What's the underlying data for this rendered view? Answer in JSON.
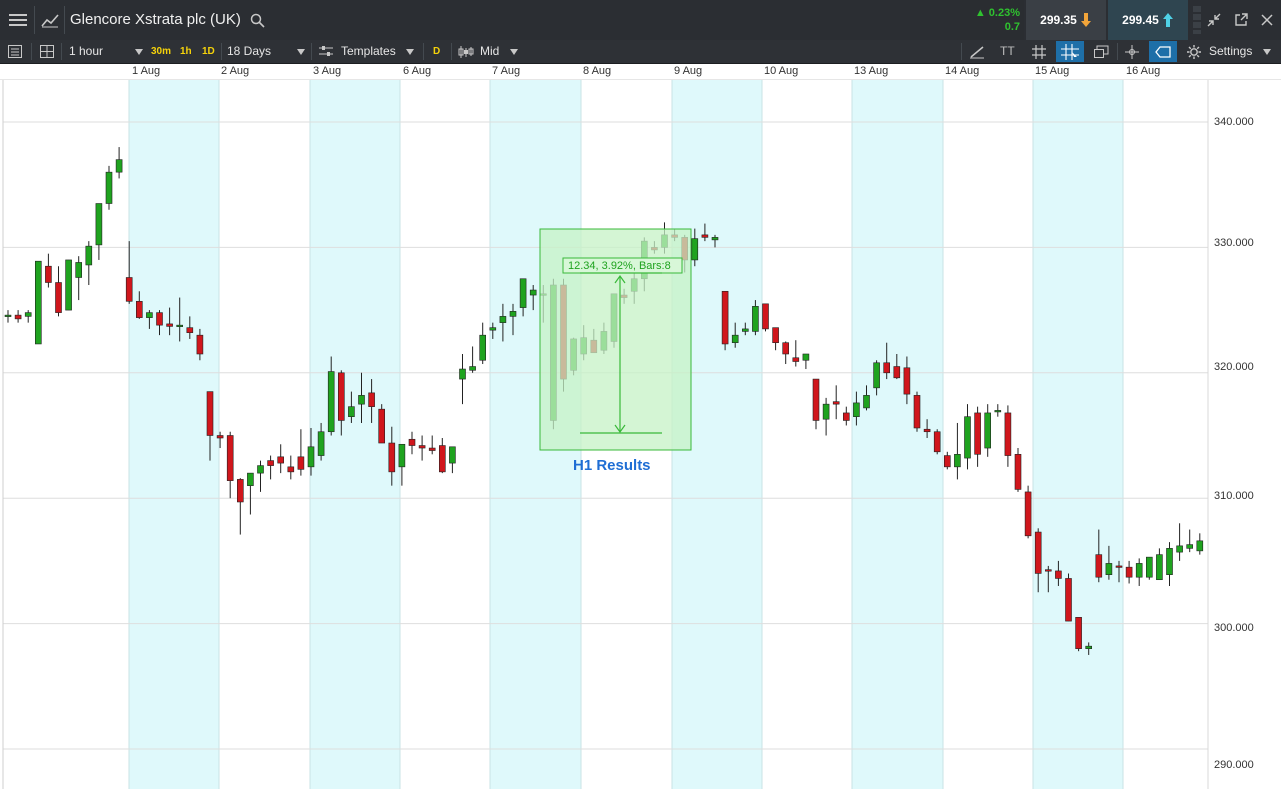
{
  "header": {
    "title": "Glencore Xstrata plc (UK)",
    "change_pct": "▲ 0.23%",
    "change_abs": "0.7",
    "sell_price": "299.35",
    "buy_price": "299.45"
  },
  "toolbar": {
    "interval": "1 hour",
    "quick_30m": "30m",
    "quick_1h": "1h",
    "quick_1d": "1D",
    "range": "18 Days",
    "templates": "Templates",
    "d_label": "D",
    "price_type": "Mid",
    "tt_label": "TT",
    "settings": "Settings"
  },
  "dates": [
    "1 Aug",
    "2 Aug",
    "3 Aug",
    "6 Aug",
    "7 Aug",
    "8 Aug",
    "9 Aug",
    "10 Aug",
    "13 Aug",
    "14 Aug",
    "15 Aug",
    "16 Aug"
  ],
  "yaxis": [
    "340.000",
    "330.000",
    "320.000",
    "310.000",
    "300.000",
    "290.000"
  ],
  "annotation": {
    "measure": "12.34, 3.92%, Bars:8",
    "label": "H1 Results"
  },
  "colors": {
    "up": "#1fa31f",
    "down": "#d0161c",
    "band": "#dff9fb",
    "box": "#b8ecb8",
    "label": "#1f6ed4"
  },
  "chart_data": {
    "type": "candlestick",
    "ylim": [
      288,
      344
    ],
    "x": [
      "1 Aug",
      "2 Aug",
      "3 Aug",
      "6 Aug",
      "7 Aug",
      "8 Aug",
      "9 Aug",
      "10 Aug",
      "13 Aug",
      "14 Aug",
      "15 Aug",
      "16 Aug"
    ],
    "candles": [
      [
        324.5,
        325,
        324,
        324.6
      ],
      [
        324.6,
        325,
        324,
        324.3
      ],
      [
        324.5,
        325,
        324,
        324.8
      ],
      [
        322.3,
        322,
        329,
        328.9
      ],
      [
        328.5,
        329.5,
        326.8,
        327.2
      ],
      [
        327.2,
        328.5,
        324.5,
        324.8
      ],
      [
        325,
        329,
        325,
        329
      ],
      [
        327.6,
        329.3,
        325.8,
        328.8
      ],
      [
        328.6,
        330.5,
        327,
        330.1
      ],
      [
        330.2,
        332.5,
        329,
        333.5
      ],
      [
        333.5,
        336.5,
        333,
        336
      ],
      [
        336,
        338,
        335.5,
        337
      ],
      [
        327.6,
        330.5,
        325.5,
        325.7
      ],
      [
        325.7,
        326.5,
        324.3,
        324.4
      ],
      [
        324.4,
        325,
        323.5,
        324.8
      ],
      [
        324.8,
        325,
        323,
        323.8
      ],
      [
        323.9,
        325.2,
        323,
        323.7
      ],
      [
        323.7,
        326,
        322.5,
        323.8
      ],
      [
        323.6,
        324.5,
        322.7,
        323.2
      ],
      [
        323,
        323.5,
        321,
        321.5
      ],
      [
        318.5,
        318.5,
        313,
        315
      ],
      [
        315,
        315.3,
        314,
        314.8
      ],
      [
        315,
        315.3,
        310,
        311.4
      ],
      [
        311.5,
        311.6,
        307.1,
        309.7
      ],
      [
        311,
        311.7,
        308.7,
        312
      ],
      [
        312,
        313,
        310.5,
        312.6
      ],
      [
        313,
        313.4,
        311.5,
        312.6
      ],
      [
        313.3,
        314.3,
        312,
        312.8
      ],
      [
        312.5,
        313.4,
        311.5,
        312.1
      ],
      [
        313.3,
        315.5,
        311.8,
        312.3
      ],
      [
        312.5,
        315.6,
        311.8,
        314.1
      ],
      [
        313.4,
        316,
        313,
        315.3
      ],
      [
        315.3,
        321.3,
        315,
        320.1
      ],
      [
        320,
        320.2,
        315,
        316.2
      ],
      [
        316.5,
        318.5,
        316,
        317.3
      ],
      [
        317.5,
        320,
        316,
        318.2
      ],
      [
        318.4,
        319.5,
        316,
        317.3
      ],
      [
        317.1,
        317.5,
        314.8,
        314.4
      ],
      [
        314.4,
        315.7,
        311,
        312.1
      ],
      [
        312.5,
        314,
        311,
        314.3
      ],
      [
        314.7,
        315.3,
        313.5,
        314.2
      ],
      [
        314.2,
        315,
        313,
        314
      ],
      [
        314,
        315,
        313.5,
        313.8
      ],
      [
        314.2,
        314.8,
        312,
        312.1
      ],
      [
        312.8,
        314,
        312,
        314.1
      ],
      [
        319.5,
        321.5,
        317.5,
        320.3
      ],
      [
        320.2,
        322.1,
        320,
        320.5
      ],
      [
        321,
        324,
        320.7,
        323
      ],
      [
        323.4,
        324,
        322.7,
        323.6
      ],
      [
        324,
        325.5,
        322.5,
        324.5
      ],
      [
        324.5,
        325.5,
        323,
        324.9
      ],
      [
        325.2,
        327.5,
        324.5,
        327.5
      ],
      [
        326.2,
        327,
        325,
        326.6
      ],
      [
        326.2,
        327,
        324,
        326.3
      ],
      [
        316.2,
        327.5,
        315.5,
        327
      ],
      [
        327,
        327.5,
        318.5,
        319.5
      ],
      [
        320.2,
        322.8,
        319.8,
        322.7
      ],
      [
        321.5,
        323.8,
        321,
        322.8
      ],
      [
        322.6,
        323.5,
        321.8,
        321.6
      ],
      [
        321.8,
        324,
        321.5,
        323.3
      ],
      [
        322.5,
        326.3,
        322,
        326.3
      ],
      [
        326.2,
        326.7,
        325.5,
        326
      ],
      [
        326.5,
        328,
        325.5,
        327.5
      ],
      [
        327.5,
        330.8,
        326.5,
        330.5
      ],
      [
        330,
        330.5,
        329.5,
        329.8
      ],
      [
        330,
        332,
        329.5,
        331
      ],
      [
        331,
        331.5,
        330.5,
        330.8
      ],
      [
        330.8,
        331,
        328,
        329
      ],
      [
        329,
        331.5,
        328.5,
        330.7
      ],
      [
        331,
        331.9,
        330.5,
        330.8
      ],
      [
        330.6,
        331,
        330,
        330.8
      ],
      [
        326.5,
        326.5,
        321.8,
        322.3
      ],
      [
        322.4,
        324,
        322,
        323
      ],
      [
        323.3,
        324,
        323,
        323.5
      ],
      [
        323.3,
        325.8,
        323,
        325.3
      ],
      [
        325.5,
        325.5,
        323.3,
        323.5
      ],
      [
        323.6,
        323.6,
        321.8,
        322.4
      ],
      [
        322.4,
        322.5,
        320.7,
        321.5
      ],
      [
        321.2,
        322.6,
        320.5,
        320.9
      ],
      [
        321,
        321.3,
        320.3,
        321.5
      ],
      [
        319.5,
        319.5,
        315.5,
        316.2
      ],
      [
        316.3,
        318,
        315,
        317.5
      ],
      [
        317.7,
        319,
        316.3,
        317.5
      ],
      [
        316.8,
        317.3,
        315.8,
        316.2
      ],
      [
        316.5,
        318.5,
        315.8,
        317.6
      ],
      [
        317.2,
        319,
        317,
        318.2
      ],
      [
        318.8,
        321,
        318.2,
        320.8
      ],
      [
        320.8,
        322.4,
        319.5,
        320
      ],
      [
        320.5,
        321.5,
        319.5,
        319.6
      ],
      [
        320.4,
        321.3,
        317.5,
        318.3
      ],
      [
        318.2,
        318.5,
        315.3,
        315.6
      ],
      [
        315.5,
        316.3,
        314.8,
        315.3
      ],
      [
        315.3,
        315.5,
        313.5,
        313.7
      ],
      [
        313.4,
        313.7,
        312.3,
        312.5
      ],
      [
        312.5,
        316,
        311.5,
        313.5
      ],
      [
        313.2,
        317.5,
        312.3,
        316.5
      ],
      [
        316.8,
        317.3,
        312.5,
        313.5
      ],
      [
        314,
        317.5,
        313.3,
        316.8
      ],
      [
        316.9,
        317.5,
        316.5,
        317
      ],
      [
        316.8,
        317.4,
        312.5,
        313.4
      ],
      [
        313.5,
        314,
        310.5,
        310.7
      ],
      [
        310.5,
        311,
        306.8,
        307
      ],
      [
        307.3,
        307.6,
        302.5,
        304
      ],
      [
        304.3,
        304.6,
        302.5,
        304.2
      ],
      [
        304.2,
        305,
        303,
        303.6
      ],
      [
        303.6,
        304,
        301.5,
        300.2
      ],
      [
        300.5,
        300.5,
        297.8,
        298
      ],
      [
        298,
        298.5,
        297.5,
        298.2
      ],
      [
        305.5,
        307.5,
        303.3,
        303.7
      ],
      [
        303.9,
        306.2,
        303.5,
        304.8
      ],
      [
        304.6,
        305,
        303.3,
        304.5
      ],
      [
        304.5,
        305,
        303.2,
        303.7
      ],
      [
        303.7,
        305.2,
        303,
        304.8
      ],
      [
        303.7,
        305,
        303.5,
        305.3
      ],
      [
        303.5,
        306,
        303.5,
        305.5
      ],
      [
        303.9,
        306.5,
        303,
        306
      ],
      [
        305.7,
        308,
        305,
        306.2
      ],
      [
        306,
        307.5,
        305.7,
        306.3
      ],
      [
        305.8,
        307.2,
        305.5,
        306.6
      ]
    ]
  }
}
